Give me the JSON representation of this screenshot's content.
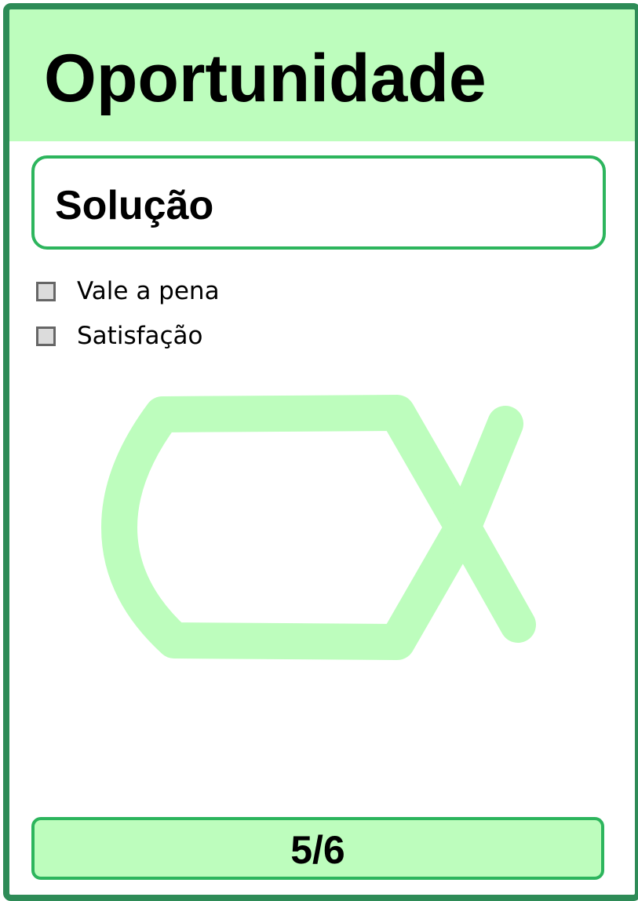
{
  "card": {
    "title": "Oportunidade",
    "subtitle": "Solução",
    "criteria": [
      {
        "label": "Vale a pena",
        "checked": false
      },
      {
        "label": "Satisfação",
        "checked": false
      }
    ],
    "illustration_icon": "fish-outline-icon",
    "page_indicator": "5/6"
  },
  "colors": {
    "border": "#2e8b57",
    "header_fill": "#bdfdbd",
    "accent_border": "#2db55d",
    "illustration": "#bdfdbd",
    "checkbox_fill": "#dcdcdc",
    "checkbox_border": "#666666"
  }
}
